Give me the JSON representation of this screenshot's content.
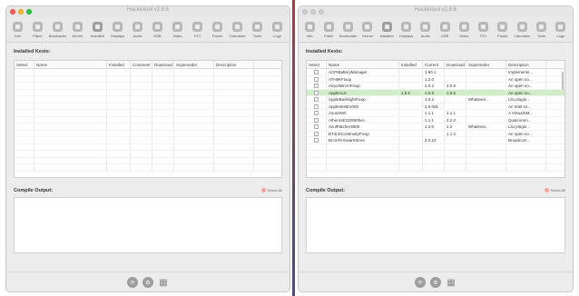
{
  "left": {
    "title": "Hackintool v2.8.6",
    "toolbar": [
      "Info",
      "Patch",
      "Bootloader",
      "Kernel",
      "Installed",
      "Displays",
      "Audio",
      "USB",
      "Disks",
      "PCI",
      "Power",
      "Calculator",
      "Tools",
      "Logs"
    ],
    "selected_tool": "Installed",
    "installed_title": "Installed Kexts:",
    "columns": [
      "Select",
      "Name",
      "Installed",
      "Comment",
      "Download",
      "Superseder",
      "Description"
    ],
    "rows": [],
    "compile_title": "Compile Output:",
    "select_label": "Select All"
  },
  "right": {
    "title": "Hackintool v2.8.6",
    "toolbar": [
      "Info",
      "Patch",
      "Bootloader",
      "Kernel",
      "Installed",
      "Displays",
      "Audio",
      "USB",
      "Disks",
      "PCI",
      "Power",
      "Calculator",
      "Tools",
      "Logs"
    ],
    "selected_tool": "Installed",
    "installed_title": "Installed Kexts:",
    "columns": [
      "Select",
      "Name",
      "Installed",
      "Current",
      "Download",
      "Superseder",
      "Description"
    ],
    "rows": [
      {
        "name": "ACPIBatteryManager",
        "installed": "",
        "current": "1.90.1",
        "download": "",
        "superseder": "",
        "description": "Implements..."
      },
      {
        "name": "ATH9KFixup",
        "installed": "",
        "current": "1.2.0",
        "download": "",
        "superseder": "",
        "description": "An open so..."
      },
      {
        "name": "AirportBrcmFixup",
        "installed": "",
        "current": "2.0.2",
        "download": "2.0.8",
        "superseder": "",
        "description": "An open so..."
      },
      {
        "name": "AppleALC",
        "installed": "1.5.6",
        "current": "1.5.9",
        "download": "1.5.6",
        "superseder": "",
        "description": "An open so...",
        "selected": true
      },
      {
        "name": "AppleBacklightFixup",
        "installed": "",
        "current": "1.0.2",
        "download": "",
        "superseder": "Whatever...",
        "description": "Lilu plugin..."
      },
      {
        "name": "AppleIntelE1000",
        "installed": "",
        "current": "1.0.0d1",
        "download": "",
        "superseder": "",
        "description": "An Intel e1..."
      },
      {
        "name": "AsusSMC",
        "installed": "",
        "current": "1.1.1",
        "download": "1.1.1",
        "superseder": "",
        "description": "A VirtualSM..."
      },
      {
        "name": "AtherosE2200Ether...",
        "installed": "",
        "current": "1.1.1",
        "download": "2.2.2",
        "superseder": "",
        "description": "Qualcomm..."
      },
      {
        "name": "AzulPatcher4600",
        "installed": "",
        "current": "1.2.0",
        "download": "1.2",
        "superseder": "Whatever...",
        "description": "Lilu plugin..."
      },
      {
        "name": "BT4LEContinuityFixup",
        "installed": "",
        "current": "",
        "download": "1.1.2",
        "superseder": "",
        "description": "An open so..."
      },
      {
        "name": "BrcmFirmwareStore",
        "installed": "",
        "current": "2.2.10",
        "download": "",
        "superseder": "",
        "description": "Broadcom..."
      }
    ],
    "compile_title": "Compile Output:",
    "select_label": "Select All"
  },
  "bottom_buttons": [
    "refresh-icon",
    "settings-icon",
    "grid-icon"
  ],
  "colors": {
    "accent_selected_row": "#cfeec8",
    "close": "#fc5f57",
    "minimize": "#fdbc2e",
    "zoom": "#28c840",
    "divider_top": "#8a4a4a",
    "divider_bottom": "#4a4e74"
  }
}
